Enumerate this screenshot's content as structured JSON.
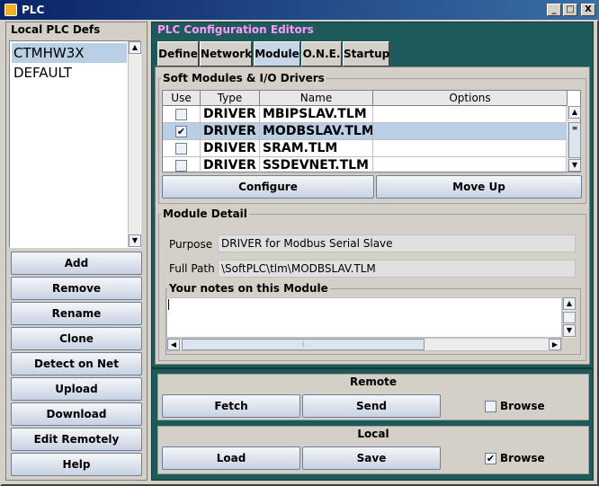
{
  "window": {
    "title": "PLC",
    "min": "_",
    "max": "□",
    "close": "X"
  },
  "left": {
    "title": "Local PLC Defs",
    "items": [
      "CTMHW3X",
      "DEFAULT"
    ],
    "buttons": [
      "Add",
      "Remove",
      "Rename",
      "Clone",
      "Detect on Net",
      "Upload",
      "Download",
      "Edit Remotely",
      "Help"
    ]
  },
  "editors": {
    "title": "PLC Configuration Editors",
    "tabs": [
      "Define",
      "Network",
      "Module",
      "O.N.E.",
      "Startup"
    ],
    "active_tab": "Module",
    "drivers": {
      "title": "Soft Modules & I/O Drivers",
      "columns": [
        "Use",
        "Type",
        "Name",
        "Options"
      ],
      "rows": [
        {
          "use": false,
          "type": "DRIVER",
          "name": "MBIPSLAV.TLM",
          "options": ""
        },
        {
          "use": true,
          "type": "DRIVER",
          "name": "MODBSLAV.TLM",
          "options": ""
        },
        {
          "use": false,
          "type": "DRIVER",
          "name": "SRAM.TLM",
          "options": ""
        },
        {
          "use": false,
          "type": "DRIVER",
          "name": "SSDEVNET.TLM",
          "options": ""
        }
      ],
      "check_mark": "✔",
      "configure": "Configure",
      "move_up": "Move Up"
    },
    "detail": {
      "title": "Module Detail",
      "purpose_label": "Purpose",
      "purpose": "DRIVER for Modbus Serial Slave",
      "path_label": "Full Path",
      "path": "\\SoftPLC\\tlm\\MODBSLAV.TLM",
      "notes_label": "Your notes on this Module",
      "notes": ""
    }
  },
  "remote": {
    "title": "Remote",
    "fetch": "Fetch",
    "send": "Send",
    "browse": "Browse",
    "browse_checked": false
  },
  "local": {
    "title": "Local",
    "load": "Load",
    "save": "Save",
    "browse": "Browse",
    "browse_checked": true
  }
}
